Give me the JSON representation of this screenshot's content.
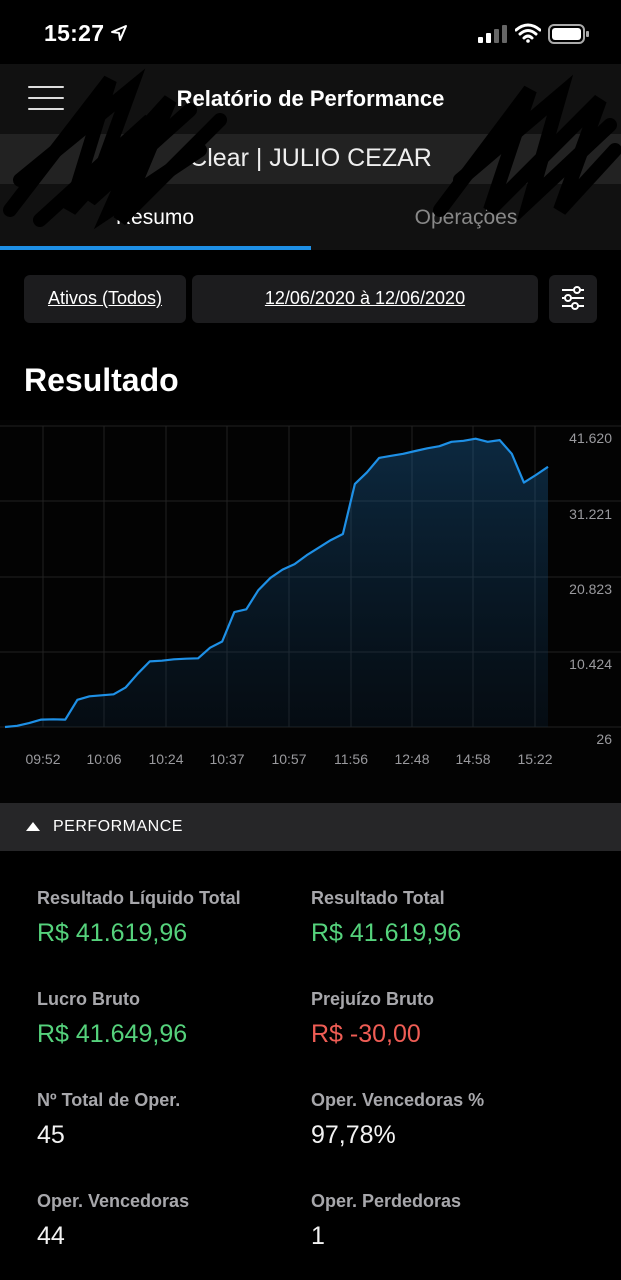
{
  "status_bar": {
    "time": "15:27",
    "location_icon": "location-arrow-icon",
    "signal_icon": "cellular-signal-icon",
    "wifi_icon": "wifi-icon",
    "battery_icon": "battery-icon"
  },
  "header": {
    "menu_icon": "hamburger-menu-icon",
    "title": "Relatório de Performance"
  },
  "account": {
    "label": "Clear | JULIO CEZAR"
  },
  "tabs": [
    {
      "label": "Resumo",
      "active": true
    },
    {
      "label": "Operações",
      "active": false
    }
  ],
  "filters": {
    "assets": "Ativos (Todos)",
    "date_range": "12/06/2020 à 12/06/2020",
    "settings_icon": "sliders-icon"
  },
  "section_title": "Resultado",
  "colors": {
    "accent": "#1e90e6",
    "positive": "#55d27c",
    "negative": "#ef5d55",
    "background": "#000000"
  },
  "chart_data": {
    "type": "area",
    "x_ticks": [
      "09:52",
      "10:06",
      "10:24",
      "10:37",
      "10:57",
      "11:56",
      "12:48",
      "14:58",
      "15:22"
    ],
    "y_ticks": [
      "41.620",
      "31.221",
      "20.823",
      "10.424",
      "26"
    ],
    "ylim": [
      26,
      41620
    ],
    "grid": true,
    "y_axis_position": "right",
    "series": [
      {
        "values": [
          26,
          200,
          600,
          1100,
          1150,
          1100,
          4000,
          4500,
          4650,
          4800,
          5800,
          7800,
          9600,
          9700,
          9900,
          10000,
          10050,
          11600,
          12500,
          16800,
          17200,
          20000,
          21800,
          23000,
          23800,
          25100,
          26200,
          27300,
          28200,
          35500,
          37200,
          39300,
          39600,
          39900,
          40300,
          40700,
          41000,
          41650,
          41800,
          42100,
          41650,
          41900,
          39900,
          35700,
          36800,
          38000
        ]
      }
    ]
  },
  "performance": {
    "header_label": "PERFORMANCE",
    "metrics": [
      {
        "label": "Resultado Líquido Total",
        "value": "R$ 41.619,96",
        "tone": "positive"
      },
      {
        "label": "Resultado Total",
        "value": "R$ 41.619,96",
        "tone": "positive"
      },
      {
        "label": "Lucro Bruto",
        "value": "R$ 41.649,96",
        "tone": "positive"
      },
      {
        "label": "Prejuízo Bruto",
        "value": "R$ -30,00",
        "tone": "negative"
      },
      {
        "label": "Nº Total de Oper.",
        "value": "45",
        "tone": "neutral"
      },
      {
        "label": "Oper. Vencedoras %",
        "value": "97,78%",
        "tone": "neutral"
      },
      {
        "label": "Oper. Vencedoras",
        "value": "44",
        "tone": "neutral"
      },
      {
        "label": "Oper. Perdedoras",
        "value": "1",
        "tone": "neutral"
      }
    ]
  }
}
